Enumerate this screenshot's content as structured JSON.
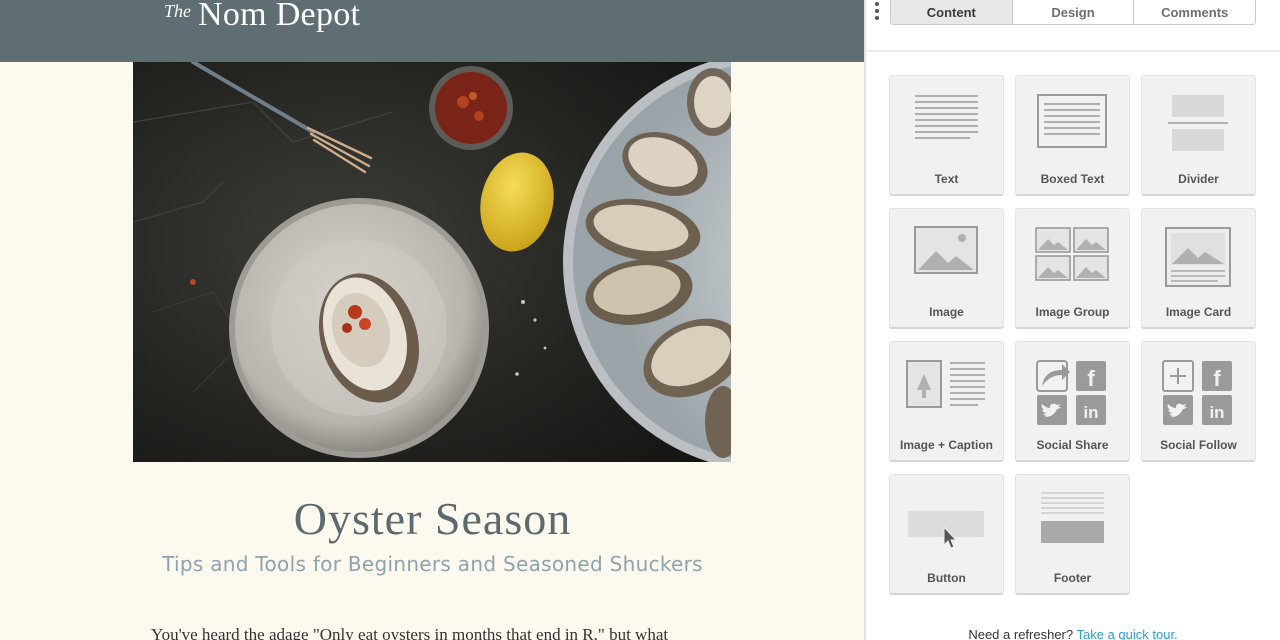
{
  "email": {
    "logo_prefix": "The",
    "logo_name": "Nom Depot",
    "headline": "Oyster Season",
    "subheadline": "Tips and Tools for Beginners and Seasoned Shuckers",
    "body_start": "You've heard the adage \"Only eat oysters in months that end in R,\" but what"
  },
  "panel": {
    "tabs": [
      {
        "label": "Content",
        "active": true
      },
      {
        "label": "Design",
        "active": false
      },
      {
        "label": "Comments",
        "active": false
      }
    ],
    "blocks": [
      {
        "label": "Text",
        "icon": "text-block-icon"
      },
      {
        "label": "Boxed Text",
        "icon": "boxed-text-block-icon"
      },
      {
        "label": "Divider",
        "icon": "divider-block-icon"
      },
      {
        "label": "Image",
        "icon": "image-block-icon"
      },
      {
        "label": "Image Group",
        "icon": "image-group-block-icon"
      },
      {
        "label": "Image Card",
        "icon": "image-card-block-icon"
      },
      {
        "label": "Image + Caption",
        "icon": "image-caption-block-icon"
      },
      {
        "label": "Social Share",
        "icon": "social-share-block-icon"
      },
      {
        "label": "Social Follow",
        "icon": "social-follow-block-icon"
      },
      {
        "label": "Button",
        "icon": "button-block-icon"
      },
      {
        "label": "Footer",
        "icon": "footer-block-icon"
      }
    ],
    "refresher_text": "Need a refresher?",
    "refresher_link": "Take a quick tour."
  },
  "colors": {
    "header_bar": "#5f6e72",
    "email_background": "#fdf9ee",
    "headline": "#5b6a6f",
    "subheadline": "#8ba4ad",
    "link": "#2a9fc6",
    "active_tab": "#e8e8e8"
  }
}
